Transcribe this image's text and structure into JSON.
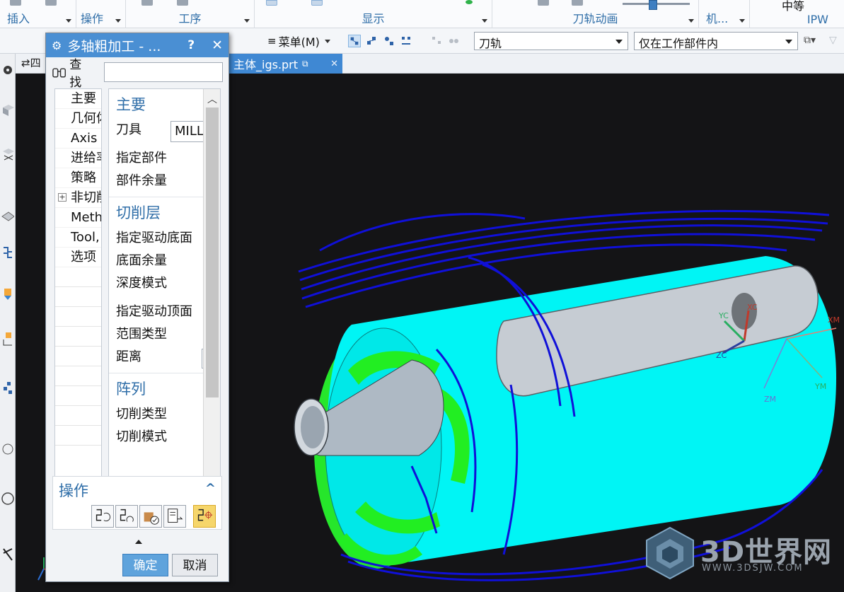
{
  "ribbon": {
    "groups": [
      {
        "label": "插入"
      },
      {
        "label": "操作"
      },
      {
        "label": "工序"
      },
      {
        "label": "显示"
      },
      {
        "label": "刀轨动画"
      },
      {
        "label": "机..."
      },
      {
        "label": "IPW"
      }
    ],
    "quality": "中等"
  },
  "toolbar": {
    "menu_label": "菜单(M)",
    "filter_type": "刀轨",
    "selection_scope": "仅在工作部件内"
  },
  "tabs": {
    "active_tab": "主体_igs.prt"
  },
  "dialog": {
    "title": "多轴粗加工 - ...",
    "help": "?",
    "find_label": "查找",
    "find_value": "",
    "nav": {
      "items": [
        {
          "label": "主要"
        },
        {
          "label": "几何体"
        },
        {
          "label": "Axis"
        },
        {
          "label": "进给率"
        },
        {
          "label": "策略"
        },
        {
          "label": "非切削"
        },
        {
          "label": "Method"
        },
        {
          "label": "Tool, Program"
        },
        {
          "label": "选项"
        }
      ],
      "expand_symbol": "+"
    },
    "sections": {
      "main": {
        "title": "主要",
        "tool_label": "刀具",
        "tool_value": "MILL (",
        "part_label": "指定部件",
        "stock_label": "部件余量"
      },
      "cut_levels": {
        "title": "切削层",
        "drive_bottom": "指定驱动底面",
        "floor_stock": "底面余量",
        "depth_mode": "深度模式",
        "drive_top": "指定驱动顶面",
        "range_type": "范围类型",
        "distance": "距离"
      },
      "pattern": {
        "title": "阵列",
        "cut_type": "切削类型",
        "cut_mode": "切削模式"
      }
    },
    "ops_title": "操作",
    "ok_label": "确定",
    "cancel_label": "取消"
  },
  "viewport": {
    "axis_labels": {
      "xc": "XC",
      "yc": "YC",
      "zc": "ZC",
      "xm": "XM",
      "ym": "YM",
      "zm": "ZM"
    }
  },
  "watermark": {
    "text": "3D世界网",
    "url": "WWW.3DSJW.COM"
  }
}
